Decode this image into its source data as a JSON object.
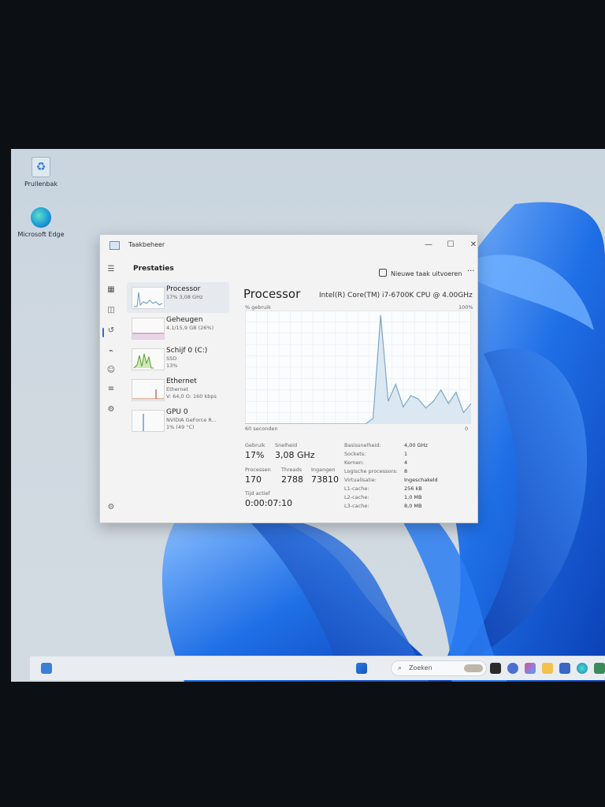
{
  "desktop": {
    "icons": [
      {
        "label": "Prullenbak",
        "icon": "recycle-bin-icon"
      },
      {
        "label": "Microsoft Edge",
        "icon": "edge-icon"
      }
    ]
  },
  "window": {
    "title": "Taakbeheer",
    "controls": {
      "minimize": "—",
      "maximize": "☐",
      "close": "✕"
    },
    "page_title": "Prestaties",
    "run_task_label": "Nieuwe taak uitvoeren",
    "more_label": "···"
  },
  "devices": [
    {
      "name": "Processor",
      "sub1": "17% 3,08 GHz",
      "sub2": "",
      "selected": true
    },
    {
      "name": "Geheugen",
      "sub1": "4,1/15,9 GB (26%)",
      "sub2": ""
    },
    {
      "name": "Schijf 0 (C:)",
      "sub1": "SSD",
      "sub2": "13%"
    },
    {
      "name": "Ethernet",
      "sub1": "Ethernet",
      "sub2": "V: 64,0 O: 160 kbps"
    },
    {
      "name": "GPU 0",
      "sub1": "NVIDIA GeForce R...",
      "sub2": "1% (49 °C)"
    }
  ],
  "main": {
    "title": "Processor",
    "model": "Intel(R) Core(TM) i7-6700K CPU @ 4.00GHz",
    "axis_top_left": "% gebruik",
    "axis_top_right": "100%",
    "axis_bottom_left": "60 seconden",
    "axis_bottom_right": "0"
  },
  "stats": {
    "usage_label": "Gebruik",
    "usage_value": "17%",
    "speed_label": "Snelheid",
    "speed_value": "3,08 GHz",
    "processes_label": "Processen",
    "processes_value": "170",
    "threads_label": "Threads",
    "threads_value": "2788",
    "handles_label": "Ingangen",
    "handles_value": "73810",
    "uptime_label": "Tijd actief",
    "uptime_value": "0:00:07:10"
  },
  "specs": [
    {
      "label": "Basissnelheid:",
      "value": "4,00 GHz"
    },
    {
      "label": "Sockets:",
      "value": "1"
    },
    {
      "label": "Kernen:",
      "value": "4"
    },
    {
      "label": "Logische processors:",
      "value": "8"
    },
    {
      "label": "Virtualisatie:",
      "value": "Ingeschakeld"
    },
    {
      "label": "L1-cache:",
      "value": "256 kB"
    },
    {
      "label": "L2-cache:",
      "value": "1,0 MB"
    },
    {
      "label": "L3-cache:",
      "value": "8,0 MB"
    }
  ],
  "taskbar": {
    "search_placeholder": "Zoeken"
  },
  "chart_data": {
    "type": "area",
    "x_range": [
      0,
      60
    ],
    "ylim": [
      0,
      100
    ],
    "grid": true,
    "series": [
      {
        "x": [
          0,
          2,
          4,
          6,
          8,
          10,
          12,
          14,
          16,
          18,
          20,
          22,
          24,
          26,
          28,
          30,
          32,
          34,
          36,
          38,
          40,
          42,
          44,
          46,
          48,
          50,
          52,
          54,
          56,
          58,
          60
        ],
        "values": [
          0,
          0,
          0,
          0,
          0,
          0,
          0,
          0,
          0,
          0,
          0,
          0,
          0,
          0,
          0,
          0,
          0,
          5,
          96,
          20,
          35,
          15,
          25,
          22,
          14,
          20,
          30,
          18,
          28,
          10,
          18
        ]
      }
    ],
    "color": "#7aa7c9"
  }
}
